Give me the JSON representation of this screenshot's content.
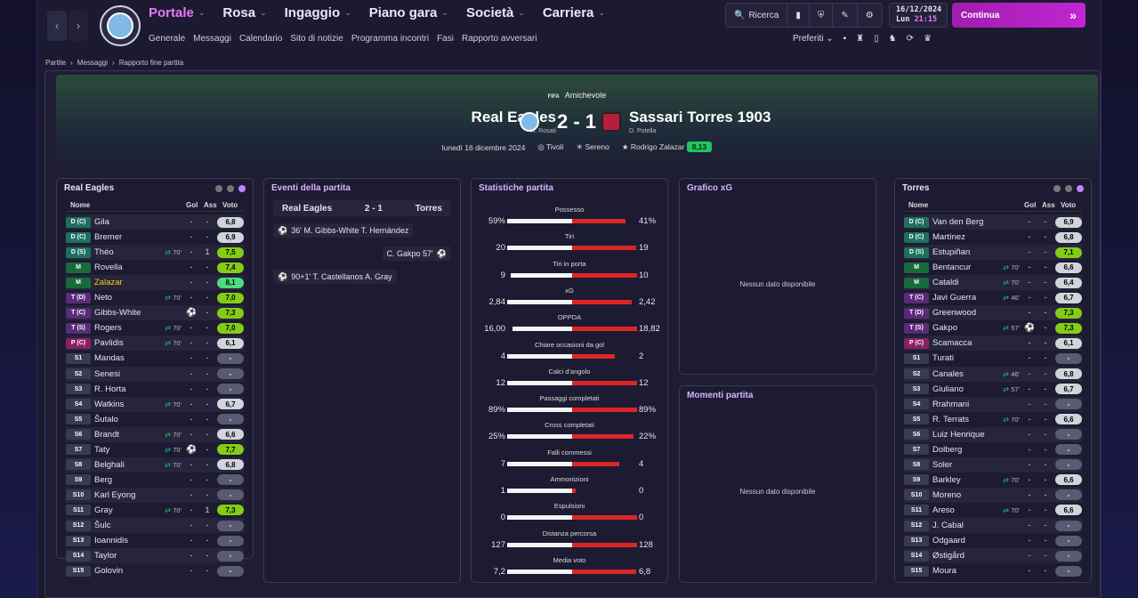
{
  "topbar": {
    "nav_back": "‹",
    "nav_fwd": "›",
    "main_nav": [
      "Portale",
      "Rosa",
      "Ingaggio",
      "Piano gara",
      "Società",
      "Carriera"
    ],
    "sub_nav": [
      "Generale",
      "Messaggi",
      "Calendario",
      "Sito di notizie",
      "Programma incontri",
      "Fasi",
      "Rapporto avversari"
    ],
    "search_label": "Ricerca",
    "date": "16/12/2024",
    "day": "Lun",
    "time": "21:15",
    "continue_label": "Continua",
    "preferiti_label": "Preferiti"
  },
  "breadcrumb": [
    "Partite",
    "Messaggi",
    "Rapporto fine partita"
  ],
  "match": {
    "competition": "Amichevole",
    "competition_logo": "FIFA",
    "home_team": "Real Eagles",
    "home_coach": "A. Rosati",
    "away_team": "Sassari Torres 1903",
    "away_coach": "D. Potella",
    "score": "2 - 1",
    "date": "lunedì 16 dicembre 2024",
    "stadium": "Tivoli",
    "weather": "Sereno",
    "potm_name": "Rodrigo Zalazar",
    "potm_rating": "8,13"
  },
  "home_panel": {
    "title": "Real Eagles",
    "col_name": "Nome",
    "col_gol": "Gol",
    "col_ass": "Ass",
    "col_voto": "Voto",
    "players": [
      {
        "pos": "D (C)",
        "cls": "D",
        "name": "Gila",
        "sub": "",
        "g": "-",
        "a": "-",
        "v": "6,8",
        "vc": "r2"
      },
      {
        "pos": "D (C)",
        "cls": "D",
        "name": "Bremer",
        "sub": "",
        "g": "-",
        "a": "-",
        "v": "6,9",
        "vc": "r2"
      },
      {
        "pos": "D (S)",
        "cls": "D",
        "name": "Théo",
        "sub": "70'",
        "g": "-",
        "a": "1",
        "v": "7,5",
        "vc": "r1"
      },
      {
        "pos": "M",
        "cls": "M",
        "name": "Rovella",
        "sub": "",
        "g": "-",
        "a": "-",
        "v": "7,4",
        "vc": "r1"
      },
      {
        "pos": "M",
        "cls": "M",
        "name": "Zalazar",
        "sub": "",
        "g": "-",
        "a": "-",
        "v": "8,1",
        "vc": "r3",
        "hl": true
      },
      {
        "pos": "T (D)",
        "cls": "T",
        "name": "Neto",
        "sub": "70'",
        "g": "-",
        "a": "-",
        "v": "7,0",
        "vc": "r1"
      },
      {
        "pos": "T (C)",
        "cls": "T",
        "name": "Gibbs-White",
        "sub": "",
        "g": "⚽",
        "a": "-",
        "v": "7,3",
        "vc": "r1"
      },
      {
        "pos": "T (S)",
        "cls": "T",
        "name": "Rogers",
        "sub": "70'",
        "g": "-",
        "a": "-",
        "v": "7,0",
        "vc": "r1"
      },
      {
        "pos": "P (C)",
        "cls": "P",
        "name": "Pavlidis",
        "sub": "70'",
        "g": "-",
        "a": "-",
        "v": "6,1",
        "vc": "r2"
      },
      {
        "pos": "S1",
        "cls": "S",
        "name": "Mandas",
        "sub": "",
        "g": "-",
        "a": "-",
        "v": "-",
        "vc": "dash"
      },
      {
        "pos": "S2",
        "cls": "S",
        "name": "Senesi",
        "sub": "",
        "g": "-",
        "a": "-",
        "v": "-",
        "vc": "dash"
      },
      {
        "pos": "S3",
        "cls": "S",
        "name": "R. Horta",
        "sub": "",
        "g": "-",
        "a": "-",
        "v": "-",
        "vc": "dash"
      },
      {
        "pos": "S4",
        "cls": "S",
        "name": "Watkins",
        "sub": "70'",
        "g": "-",
        "a": "-",
        "v": "6,7",
        "vc": "r2"
      },
      {
        "pos": "S5",
        "cls": "S",
        "name": "Šutalo",
        "sub": "",
        "g": "-",
        "a": "-",
        "v": "-",
        "vc": "dash"
      },
      {
        "pos": "S6",
        "cls": "S",
        "name": "Brandt",
        "sub": "70'",
        "g": "-",
        "a": "-",
        "v": "6,6",
        "vc": "r2"
      },
      {
        "pos": "S7",
        "cls": "S",
        "name": "Taty",
        "sub": "70'",
        "g": "⚽",
        "a": "-",
        "v": "7,7",
        "vc": "r1"
      },
      {
        "pos": "S8",
        "cls": "S",
        "name": "Belghali",
        "sub": "70'",
        "g": "-",
        "a": "-",
        "v": "6,8",
        "vc": "r2"
      },
      {
        "pos": "S9",
        "cls": "S",
        "name": "Berg",
        "sub": "",
        "g": "-",
        "a": "-",
        "v": "-",
        "vc": "dash"
      },
      {
        "pos": "S10",
        "cls": "S",
        "name": "Karl Eyong",
        "sub": "",
        "g": "-",
        "a": "-",
        "v": "-",
        "vc": "dash"
      },
      {
        "pos": "S11",
        "cls": "S",
        "name": "Gray",
        "sub": "70'",
        "g": "-",
        "a": "1",
        "v": "7,3",
        "vc": "r1"
      },
      {
        "pos": "S12",
        "cls": "S",
        "name": "Šulc",
        "sub": "",
        "g": "-",
        "a": "-",
        "v": "-",
        "vc": "dash"
      },
      {
        "pos": "S13",
        "cls": "S",
        "name": "Ioannidis",
        "sub": "",
        "g": "-",
        "a": "-",
        "v": "-",
        "vc": "dash"
      },
      {
        "pos": "S14",
        "cls": "S",
        "name": "Taylor",
        "sub": "",
        "g": "-",
        "a": "-",
        "v": "-",
        "vc": "dash"
      },
      {
        "pos": "S15",
        "cls": "S",
        "name": "Golovin",
        "sub": "",
        "g": "-",
        "a": "-",
        "v": "-",
        "vc": "dash"
      }
    ]
  },
  "events_panel": {
    "title": "Eventi della partita",
    "home": "Real Eagles",
    "score": "2 - 1",
    "away": "Torres",
    "events": [
      {
        "side": "home",
        "text": "36'  M. Gibbs-White  T. Hernández"
      },
      {
        "side": "away",
        "text": "C. Gakpo  57'"
      },
      {
        "side": "home",
        "text": "90+1'  T. Castellanos  A. Gray"
      }
    ]
  },
  "stats_panel": {
    "title": "Statistiche partita",
    "stats": [
      {
        "label": "Possesso",
        "l": "59%",
        "r": "41%",
        "lp": 59,
        "rp": 41
      },
      {
        "label": "Tiri",
        "l": "20",
        "r": "19",
        "lp": 51,
        "rp": 49
      },
      {
        "label": "Tiri in porta",
        "l": "9",
        "r": "10",
        "lp": 47,
        "rp": 53
      },
      {
        "label": "xG",
        "l": "2,84",
        "r": "2,42",
        "lp": 54,
        "rp": 46
      },
      {
        "label": "OPPDA",
        "l": "16,00",
        "r": "18,82",
        "lp": 46,
        "rp": 54
      },
      {
        "label": "Chiare occasioni da gol",
        "l": "4",
        "r": "2",
        "lp": 67,
        "rp": 33
      },
      {
        "label": "Calci d'angolo",
        "l": "12",
        "r": "12",
        "lp": 50,
        "rp": 50
      },
      {
        "label": "Passaggi completati",
        "l": "89%",
        "r": "89%",
        "lp": 50,
        "rp": 50
      },
      {
        "label": "Cross completati",
        "l": "25%",
        "r": "22%",
        "lp": 53,
        "rp": 47
      },
      {
        "label": "Falli commessi",
        "l": "7",
        "r": "4",
        "lp": 64,
        "rp": 36
      },
      {
        "label": "Ammonizioni",
        "l": "1",
        "r": "0",
        "lp": 97,
        "rp": 3
      },
      {
        "label": "Espulsioni",
        "l": "0",
        "r": "0",
        "lp": 50,
        "rp": 50
      },
      {
        "label": "Distanza percorsa",
        "l": "127",
        "r": "128",
        "lp": 50,
        "rp": 50
      },
      {
        "label": "Media voto",
        "l": "7,2",
        "r": "6,8",
        "lp": 51,
        "rp": 49
      }
    ]
  },
  "xg_panel": {
    "title": "Grafico xG",
    "empty": "Nessun dato disponibile"
  },
  "moments_panel": {
    "title": "Momenti partita",
    "empty": "Nessun dato disponibile"
  },
  "away_panel": {
    "title": "Torres",
    "col_name": "Nome",
    "col_gol": "Gol",
    "col_ass": "Ass",
    "col_voto": "Voto",
    "players": [
      {
        "pos": "D (C)",
        "cls": "D",
        "name": "Van den Berg",
        "sub": "",
        "g": "-",
        "a": "-",
        "v": "6,9",
        "vc": "r2"
      },
      {
        "pos": "D (C)",
        "cls": "D",
        "name": "Martínez",
        "sub": "",
        "g": "-",
        "a": "-",
        "v": "6,8",
        "vc": "r2"
      },
      {
        "pos": "D (S)",
        "cls": "D",
        "name": "Estupiñan",
        "sub": "",
        "g": "-",
        "a": "-",
        "v": "7,1",
        "vc": "r1"
      },
      {
        "pos": "M",
        "cls": "M",
        "name": "Bentancur",
        "sub": "70'",
        "g": "-",
        "a": "-",
        "v": "6,6",
        "vc": "r2"
      },
      {
        "pos": "M",
        "cls": "M",
        "name": "Cataldi",
        "sub": "70'",
        "g": "-",
        "a": "-",
        "v": "6,4",
        "vc": "r2"
      },
      {
        "pos": "T (C)",
        "cls": "T",
        "name": "Javi Guerra",
        "sub": "46'",
        "g": "-",
        "a": "-",
        "v": "6,7",
        "vc": "r2"
      },
      {
        "pos": "T (D)",
        "cls": "T",
        "name": "Greenwood",
        "sub": "",
        "g": "-",
        "a": "-",
        "v": "7,3",
        "vc": "r1"
      },
      {
        "pos": "T (S)",
        "cls": "T",
        "name": "Gakpo",
        "sub": "57'",
        "g": "⚽",
        "a": "-",
        "v": "7,3",
        "vc": "r1"
      },
      {
        "pos": "P (C)",
        "cls": "P",
        "name": "Scamacca",
        "sub": "",
        "g": "-",
        "a": "-",
        "v": "6,1",
        "vc": "r2"
      },
      {
        "pos": "S1",
        "cls": "S",
        "name": "Turati",
        "sub": "",
        "g": "-",
        "a": "-",
        "v": "-",
        "vc": "dash"
      },
      {
        "pos": "S2",
        "cls": "S",
        "name": "Canales",
        "sub": "46'",
        "g": "-",
        "a": "-",
        "v": "6,8",
        "vc": "r2"
      },
      {
        "pos": "S3",
        "cls": "S",
        "name": "Giuliano",
        "sub": "57'",
        "g": "-",
        "a": "-",
        "v": "6,7",
        "vc": "r2"
      },
      {
        "pos": "S4",
        "cls": "S",
        "name": "Rrahmani",
        "sub": "",
        "g": "-",
        "a": "-",
        "v": "-",
        "vc": "dash"
      },
      {
        "pos": "S5",
        "cls": "S",
        "name": "R. Terrats",
        "sub": "70'",
        "g": "-",
        "a": "-",
        "v": "6,6",
        "vc": "r2"
      },
      {
        "pos": "S6",
        "cls": "S",
        "name": "Luiz Henrique",
        "sub": "",
        "g": "-",
        "a": "-",
        "v": "-",
        "vc": "dash"
      },
      {
        "pos": "S7",
        "cls": "S",
        "name": "Dolberg",
        "sub": "",
        "g": "-",
        "a": "-",
        "v": "-",
        "vc": "dash"
      },
      {
        "pos": "S8",
        "cls": "S",
        "name": "Soler",
        "sub": "",
        "g": "-",
        "a": "-",
        "v": "-",
        "vc": "dash"
      },
      {
        "pos": "S9",
        "cls": "S",
        "name": "Barkley",
        "sub": "70'",
        "g": "-",
        "a": "-",
        "v": "6,6",
        "vc": "r2"
      },
      {
        "pos": "S10",
        "cls": "S",
        "name": "Moreno",
        "sub": "",
        "g": "-",
        "a": "-",
        "v": "-",
        "vc": "dash"
      },
      {
        "pos": "S11",
        "cls": "S",
        "name": "Areso",
        "sub": "70'",
        "g": "-",
        "a": "-",
        "v": "6,6",
        "vc": "r2"
      },
      {
        "pos": "S12",
        "cls": "S",
        "name": "J. Cabal",
        "sub": "",
        "g": "-",
        "a": "-",
        "v": "-",
        "vc": "dash"
      },
      {
        "pos": "S13",
        "cls": "S",
        "name": "Odgaard",
        "sub": "",
        "g": "-",
        "a": "-",
        "v": "-",
        "vc": "dash"
      },
      {
        "pos": "S14",
        "cls": "S",
        "name": "Østigård",
        "sub": "",
        "g": "-",
        "a": "-",
        "v": "-",
        "vc": "dash"
      },
      {
        "pos": "S15",
        "cls": "S",
        "name": "Moura",
        "sub": "",
        "g": "-",
        "a": "-",
        "v": "-",
        "vc": "dash"
      }
    ]
  }
}
